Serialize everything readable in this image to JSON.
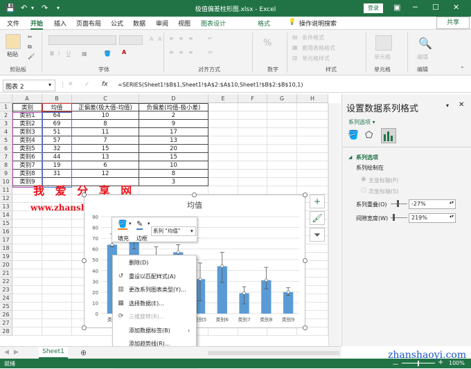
{
  "title_bar": {
    "title": "极值偏差柱形图.xlsx  -  Excel",
    "login": "登录",
    "save_icon": "save-icon",
    "colors": {
      "brand": "#217346"
    }
  },
  "menu": {
    "tabs": [
      "文件",
      "开始",
      "插入",
      "页面布局",
      "公式",
      "数据",
      "审阅",
      "视图",
      "图表设计",
      "格式"
    ],
    "active": "开始",
    "context_tabs": [
      "图表设计",
      "格式"
    ],
    "tellme": "操作说明搜索",
    "share": "共享"
  },
  "ribbon": {
    "paste": "粘贴",
    "clipboard": "剪贴板",
    "font": "字体",
    "alignment": "对齐方式",
    "number": "数字",
    "cond_format": "条件格式",
    "table_format": "套用表格格式",
    "cell_style": "单元格样式",
    "styles": "样式",
    "cells_btn": "单元格",
    "cells": "单元格",
    "editing_btn": "编辑",
    "editing": "编辑",
    "bold": "B",
    "italic": "I",
    "underline": "U",
    "percent": "%"
  },
  "formula_bar": {
    "name_box": "图表 2",
    "fx": "fx",
    "formula": "=SERIES(Sheet1!$B$1,Sheet1!$A$2:$A$10,Sheet1!$B$2:$B$10,1)"
  },
  "sheet": {
    "columns": [
      "A",
      "B",
      "C",
      "D",
      "E",
      "F",
      "G",
      "H"
    ],
    "rows": [
      "1",
      "2",
      "3",
      "4",
      "5",
      "6",
      "7",
      "8",
      "9",
      "10",
      "11",
      "12",
      "13",
      "14",
      "15",
      "16",
      "17",
      "18",
      "19",
      "20",
      "21",
      "22",
      "23",
      "24",
      "25",
      "26",
      "27",
      "28"
    ],
    "headers": [
      "类别",
      "均值",
      "正偏差(极大值-均值)",
      "负偏差(均值-极小差)"
    ],
    "data": [
      [
        "类别1",
        "64",
        "10",
        "2"
      ],
      [
        "类别2",
        "69",
        "8",
        "9"
      ],
      [
        "类别3",
        "51",
        "11",
        "17"
      ],
      [
        "类别4",
        "57",
        "7",
        "13"
      ],
      [
        "类别5",
        "32",
        "15",
        "20"
      ],
      [
        "类别6",
        "44",
        "13",
        "15"
      ],
      [
        "类别7",
        "19",
        "6",
        "10"
      ],
      [
        "类别8",
        "31",
        "12",
        "8"
      ],
      [
        "类别9",
        "",
        "",
        "3"
      ]
    ]
  },
  "watermark": {
    "cn": "我 爱 分 享 网",
    "url": "www.zhanshaoyi.com",
    "bottom": "zhanshaoyi.com"
  },
  "chart_data": {
    "type": "bar",
    "title": "均值",
    "categories": [
      "类别1",
      "类别2",
      "类别3",
      "类别4",
      "类别5",
      "类别6",
      "类别7",
      "类别8",
      "类别9"
    ],
    "series": [
      {
        "values": [
          64,
          69,
          51,
          57,
          32,
          44,
          19,
          31,
          20
        ],
        "error_plus": [
          10,
          8,
          11,
          7,
          15,
          13,
          6,
          12,
          4
        ],
        "error_minus": [
          2,
          9,
          17,
          13,
          20,
          15,
          10,
          8,
          3
        ]
      }
    ],
    "ylim": [
      0,
      90
    ],
    "yticks": [
      0,
      10,
      20,
      30,
      40,
      50,
      60,
      70,
      80,
      90
    ],
    "visible_tick_labels": [
      "0",
      "10",
      "20",
      "30",
      "40",
      "50",
      "60",
      "70",
      "80",
      "90"
    ],
    "visible_category_labels": [
      "类别",
      "类别5",
      "类别6",
      "类别7",
      "类别8",
      "类别9"
    ],
    "bar_color": "#5b9bd5"
  },
  "chart_buttons": [
    "+",
    "brush",
    "filter"
  ],
  "mini_toolbar": {
    "fill": "填充",
    "border": "边框",
    "series": "系列 \"均值\""
  },
  "context_menu": [
    {
      "label": "删除(D)",
      "icon": "",
      "disabled": false
    },
    {
      "label": "重设以匹配样式(A)",
      "icon": "reset-icon",
      "disabled": false
    },
    {
      "label": "更改系列图表类型(Y)...",
      "icon": "chart-type-icon",
      "disabled": false
    },
    {
      "label": "选择数据(E)...",
      "icon": "select-data-icon",
      "disabled": false
    },
    {
      "label": "三维旋转(R)...",
      "icon": "rotate-3d-icon",
      "disabled": true
    },
    {
      "label": "添加数据标签(B)",
      "icon": "",
      "disabled": false,
      "submenu": true
    },
    {
      "label": "添加趋势线(R)...",
      "icon": "",
      "disabled": false
    },
    {
      "label": "设置数据系列格式(F)...",
      "icon": "format-series-icon",
      "disabled": false,
      "highlighted": true
    }
  ],
  "format_pane": {
    "title": "设置数据系列格式",
    "series_options_dropdown": "系列选项",
    "section": "系列选项",
    "plot_on": "系列绘制在",
    "primary_axis": "主坐标轴(P)",
    "secondary_axis": "次坐标轴(S)",
    "overlap_label": "系列重叠(O)",
    "overlap_value": "-27%",
    "gap_label": "间隙宽度(W)",
    "gap_value": "219%"
  },
  "sheet_tabs": {
    "active": "Sheet1"
  },
  "status": {
    "ready": "就绪",
    "zoom": "100%",
    "minus": "－",
    "plus": "+"
  }
}
